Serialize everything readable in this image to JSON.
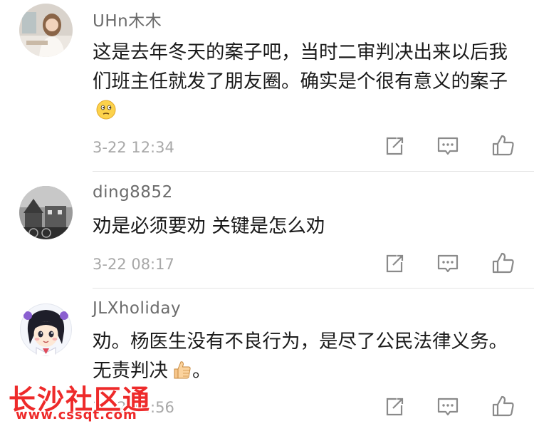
{
  "comments": [
    {
      "username": "UHn木木",
      "text": "这是去年冬天的案子吧，当时二审判决出来以后我们班主任就发了朋友圈。确实是个很有意义的案子",
      "emoji": "thinking-face",
      "time": "3-22 12:34"
    },
    {
      "username": "ding8852",
      "text": "劝是必须要劝 关键是怎么劝",
      "time": "3-22 08:17"
    },
    {
      "username": "JLXholiday",
      "text": "劝。杨医生没有不良行为，是尽了公民法律义务。无责判决",
      "emoji": "thumbs-up",
      "text_after": "。",
      "time": "3-22 12:56"
    }
  ],
  "actions": [
    "share-icon",
    "comment-icon",
    "like-icon"
  ],
  "watermark": {
    "name": "长沙社区通",
    "url": "www.cssqt.com"
  },
  "colors": {
    "username": "#6b6b6b",
    "text": "#1a1a1a",
    "time": "#a8a8a8",
    "watermark": "#ee2a2a"
  }
}
